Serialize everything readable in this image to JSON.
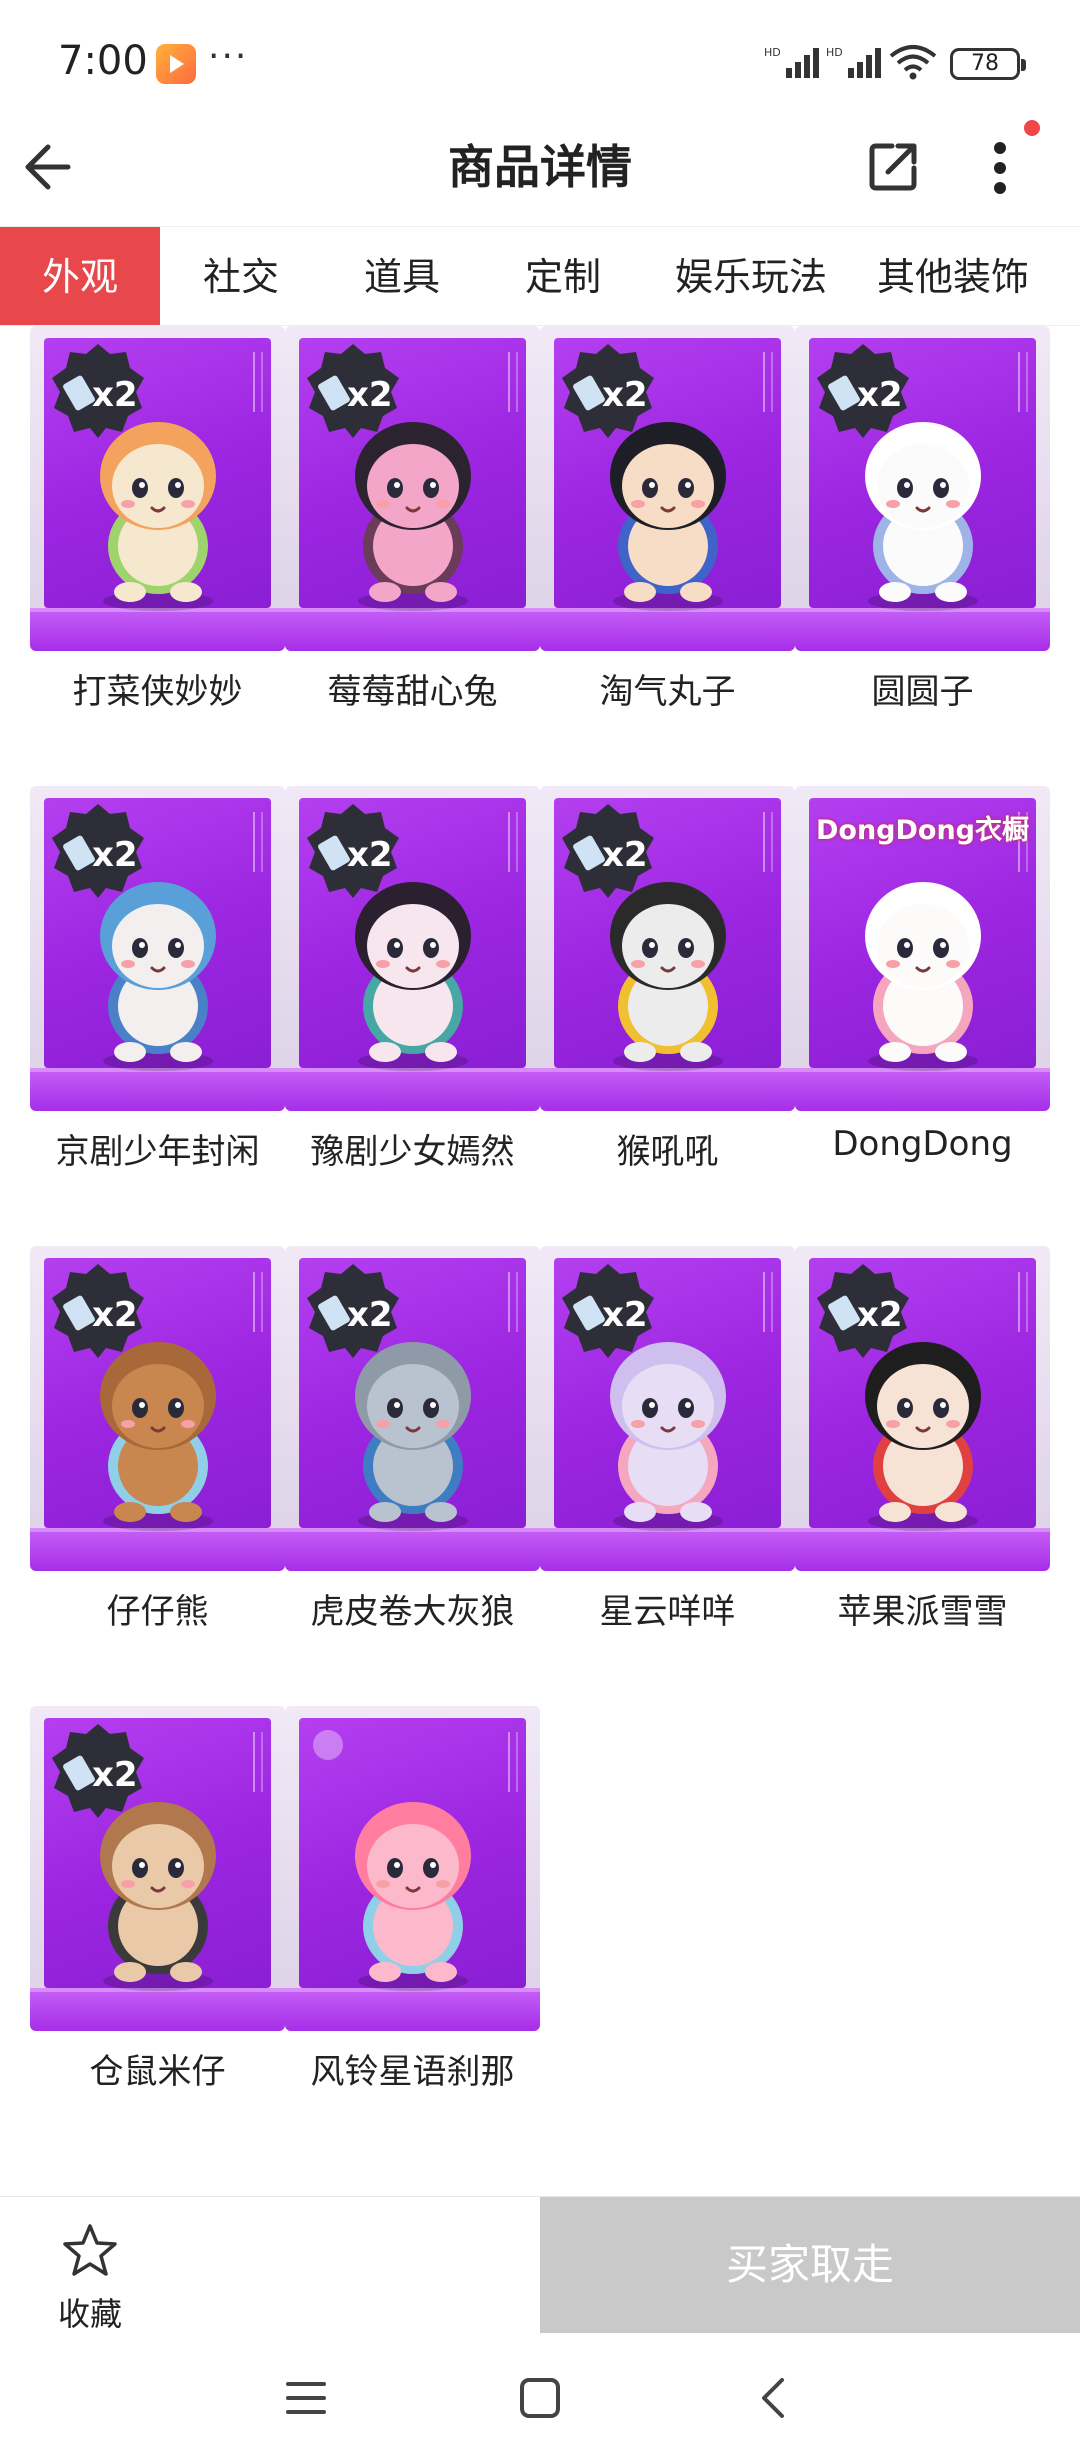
{
  "status_bar": {
    "time": "7:00",
    "dots": "···",
    "battery": "78"
  },
  "header": {
    "title": "商品详情"
  },
  "tabs": [
    {
      "label": "外观",
      "active": true
    },
    {
      "label": "社交",
      "active": false
    },
    {
      "label": "道具",
      "active": false
    },
    {
      "label": "定制",
      "active": false
    },
    {
      "label": "娱乐玩法",
      "active": false
    },
    {
      "label": "其他装饰",
      "active": false
    }
  ],
  "items": [
    {
      "name": "打菜侠妙妙",
      "badge": "x2",
      "banner": ""
    },
    {
      "name": "莓莓甜心兔",
      "badge": "x2",
      "banner": ""
    },
    {
      "name": "淘气丸子",
      "badge": "x2",
      "banner": ""
    },
    {
      "name": "圆圆子",
      "badge": "x2",
      "banner": ""
    },
    {
      "name": "京剧少年封闲",
      "badge": "x2",
      "banner": ""
    },
    {
      "name": "豫剧少女嫣然",
      "badge": "x2",
      "banner": ""
    },
    {
      "name": "猴吼吼",
      "badge": "x2",
      "banner": ""
    },
    {
      "name": "DongDong",
      "badge": "",
      "banner": "DongDong衣橱"
    },
    {
      "name": "仔仔熊",
      "badge": "x2",
      "banner": ""
    },
    {
      "name": "虎皮卷大灰狼",
      "badge": "x2",
      "banner": ""
    },
    {
      "name": "星云咩咩",
      "badge": "x2",
      "banner": ""
    },
    {
      "name": "苹果派雪雪",
      "badge": "x2",
      "banner": ""
    },
    {
      "name": "仓鼠米仔",
      "badge": "x2",
      "banner": ""
    },
    {
      "name": "风铃星语刹那",
      "badge": "",
      "banner": ""
    }
  ],
  "figures": [
    {
      "body": "#f6e7cf",
      "accent": "#9fd36b",
      "hair": "#f3a35e"
    },
    {
      "body": "#f4a6c8",
      "accent": "#6b3b5a",
      "hair": "#2b2430"
    },
    {
      "body": "#f7dcc6",
      "accent": "#3f63c8",
      "hair": "#1e1e26"
    },
    {
      "body": "#fbfbfb",
      "accent": "#9fb4e6",
      "hair": "#ffffff"
    },
    {
      "body": "#f3efee",
      "accent": "#4a80c8",
      "hair": "#5aa0d8"
    },
    {
      "body": "#f7e6ee",
      "accent": "#46a7a5",
      "hair": "#2a2030"
    },
    {
      "body": "#ececec",
      "accent": "#f0c030",
      "hair": "#2a2a2a"
    },
    {
      "body": "#fdfafa",
      "accent": "#f5a6bf",
      "hair": "#ffffff"
    },
    {
      "body": "#c9864e",
      "accent": "#8fd0e8",
      "hair": "#a9683a"
    },
    {
      "body": "#b9c3cf",
      "accent": "#3f7dc3",
      "hair": "#8f9aa9"
    },
    {
      "body": "#e7def6",
      "accent": "#f6a7c0",
      "hair": "#cfbfee"
    },
    {
      "body": "#f6e3d6",
      "accent": "#e04040",
      "hair": "#1e1e1e"
    },
    {
      "body": "#e9c9a8",
      "accent": "#3a3a3a",
      "hair": "#b0784c"
    },
    {
      "body": "#fdb9cc",
      "accent": "#8fd0e8",
      "hair": "#ff7ea0"
    }
  ],
  "bottom": {
    "favorite_label": "收藏",
    "buy_label": "买家取走"
  },
  "colors": {
    "accent": "#e8474b",
    "box_purple": "#a22fe6",
    "disabled_button": "#c9c9c9"
  }
}
